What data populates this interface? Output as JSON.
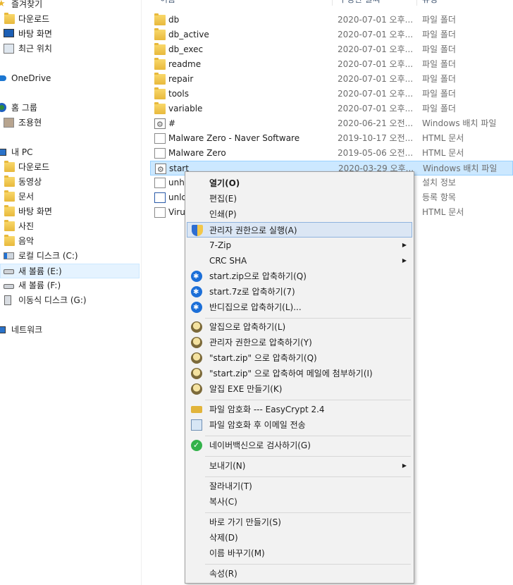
{
  "colors": {
    "selection": "#cce8ff",
    "menu_bg": "#f2f2f2",
    "menu_hot": "#dbe6f4",
    "folder": "#e8b93c"
  },
  "header": {
    "name": "이름",
    "date": "수정한 날짜",
    "type": "유형"
  },
  "nav": [
    {
      "label": "즐겨찾기",
      "icon": "star-icon"
    },
    {
      "label": "다운로드",
      "icon": "downloads-folder-icon"
    },
    {
      "label": "바탕 화면",
      "icon": "desktop-icon"
    },
    {
      "label": "최근 위치",
      "icon": "recent-places-icon"
    },
    {
      "label": "OneDrive",
      "icon": "onedrive-cloud-icon"
    },
    {
      "label": "홈 그룹",
      "icon": "homegroup-icon"
    },
    {
      "label": "조용현",
      "icon": "user-icon"
    },
    {
      "label": "내 PC",
      "icon": "pc-icon"
    },
    {
      "label": "다운로드",
      "icon": "downloads-folder-icon"
    },
    {
      "label": "동영상",
      "icon": "videos-folder-icon"
    },
    {
      "label": "문서",
      "icon": "documents-folder-icon"
    },
    {
      "label": "바탕 화면",
      "icon": "desktop-folder-icon"
    },
    {
      "label": "사진",
      "icon": "pictures-folder-icon"
    },
    {
      "label": "음악",
      "icon": "music-folder-icon"
    },
    {
      "label": "로컬 디스크 (C:)",
      "icon": "windows-drive-icon"
    },
    {
      "label": "새 볼륨 (E:)",
      "icon": "drive-icon"
    },
    {
      "label": "새 볼륨 (F:)",
      "icon": "drive-icon"
    },
    {
      "label": "이동식 디스크 (G:)",
      "icon": "usb-drive-icon"
    },
    {
      "label": "네트워크",
      "icon": "network-icon"
    }
  ],
  "files": [
    {
      "name": "db",
      "date": "2020-07-01 오후...",
      "type": "파일 폴더",
      "icon": "folder-icon"
    },
    {
      "name": "db_active",
      "date": "2020-07-01 오후...",
      "type": "파일 폴더",
      "icon": "folder-icon"
    },
    {
      "name": "db_exec",
      "date": "2020-07-01 오후...",
      "type": "파일 폴더",
      "icon": "folder-icon"
    },
    {
      "name": "readme",
      "date": "2020-07-01 오후...",
      "type": "파일 폴더",
      "icon": "folder-icon"
    },
    {
      "name": "repair",
      "date": "2020-07-01 오후...",
      "type": "파일 폴더",
      "icon": "folder-icon"
    },
    {
      "name": "tools",
      "date": "2020-07-01 오후...",
      "type": "파일 폴더",
      "icon": "folder-icon"
    },
    {
      "name": "variable",
      "date": "2020-07-01 오후...",
      "type": "파일 폴더",
      "icon": "folder-icon"
    },
    {
      "name": "#",
      "date": "2020-06-21 오전...",
      "type": "Windows 배치 파일",
      "icon": "batch-file-icon"
    },
    {
      "name": "Malware Zero - Naver Software",
      "date": "2019-10-17 오전...",
      "type": "HTML 문서",
      "icon": "html-document-icon"
    },
    {
      "name": "Malware Zero",
      "date": "2019-05-06 오전...",
      "type": "HTML 문서",
      "icon": "html-document-icon"
    },
    {
      "name": "start",
      "date": "2020-03-29 오후...",
      "type": "Windows 배치 파일",
      "icon": "batch-file-icon"
    },
    {
      "name": "unho",
      "date": "",
      "type": "설치 정보",
      "icon": "setup-info-icon"
    },
    {
      "name": "unlo",
      "date": "",
      "type": "등록 항목",
      "icon": "registry-entry-icon"
    },
    {
      "name": "Viru",
      "date": "",
      "type": "HTML 문서",
      "icon": "html-document-icon"
    }
  ],
  "context_menu": [
    {
      "label": "열기(O)",
      "bold": true
    },
    {
      "label": "편집(E)"
    },
    {
      "label": "인쇄(P)"
    },
    {
      "label": "관리자 권한으로 실행(A)",
      "icon": "uac-shield-icon",
      "hot": true
    },
    {
      "label": "7-Zip",
      "submenu": true
    },
    {
      "label": "CRC SHA",
      "submenu": true
    },
    {
      "label": "start.zip으로 압축하기(Q)",
      "icon": "bandizip-icon"
    },
    {
      "label": "start.7z로 압축하기(7)",
      "icon": "bandizip-icon"
    },
    {
      "label": "반디집으로 압축하기(L)...",
      "icon": "bandizip-icon"
    },
    {
      "label": "알집으로 압축하기(L)",
      "icon": "alzip-icon"
    },
    {
      "label": "관리자 권한으로 압축하기(Y)",
      "icon": "alzip-admin-icon"
    },
    {
      "label": "\"start.zip\" 으로 압축하기(Q)",
      "icon": "alzip-icon"
    },
    {
      "label": "\"start.zip\" 으로 압축하여 메일에 첨부하기(I)",
      "icon": "alzip-icon"
    },
    {
      "label": "알집 EXE 만들기(K)",
      "icon": "alzip-icon"
    },
    {
      "label": "파일 암호화 --- EasyCrypt 2.4",
      "icon": "lock-icon"
    },
    {
      "label": "파일 암호화 후 이메일 전송",
      "icon": "mail-icon"
    },
    {
      "label": "네이버백신으로 검사하기(G)",
      "icon": "naver-vaccine-icon"
    },
    {
      "label": "보내기(N)",
      "submenu": true
    },
    {
      "label": "잘라내기(T)"
    },
    {
      "label": "복사(C)"
    },
    {
      "label": "바로 가기 만들기(S)"
    },
    {
      "label": "삭제(D)"
    },
    {
      "label": "이름 바꾸기(M)"
    },
    {
      "label": "속성(R)"
    }
  ]
}
